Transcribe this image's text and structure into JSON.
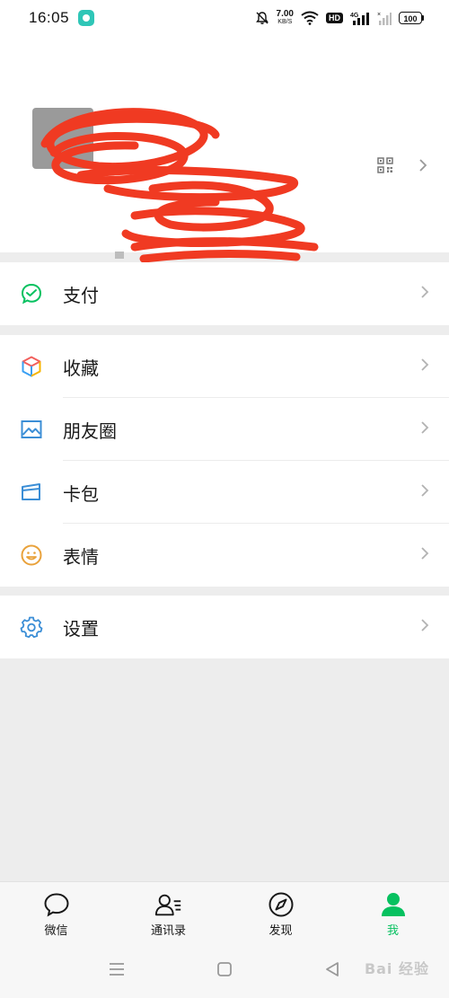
{
  "status_bar": {
    "time": "16:05",
    "net_speed_value": "7.00",
    "net_speed_unit": "KB/S",
    "hd_label": "HD",
    "signal_label": "4G",
    "battery": "100"
  },
  "profile": {
    "qr_icon": "qr-code-icon",
    "chevron_icon": "chevron-right-icon"
  },
  "menu": {
    "pay": {
      "label": "支付",
      "icon": "pay-check-icon"
    },
    "favorites": {
      "label": "收藏",
      "icon": "cube-icon"
    },
    "moments": {
      "label": "朋友圈",
      "icon": "image-icon"
    },
    "cards": {
      "label": "卡包",
      "icon": "card-wallet-icon"
    },
    "stickers": {
      "label": "表情",
      "icon": "smiley-icon"
    },
    "settings": {
      "label": "设置",
      "icon": "gear-icon"
    }
  },
  "tabbar": {
    "chats": "微信",
    "contacts": "通讯录",
    "discover": "发现",
    "me": "我"
  },
  "watermark": "Bai 经验",
  "colors": {
    "accent_green": "#07c160",
    "page_bg": "#ededed",
    "card_bg": "#ffffff"
  }
}
